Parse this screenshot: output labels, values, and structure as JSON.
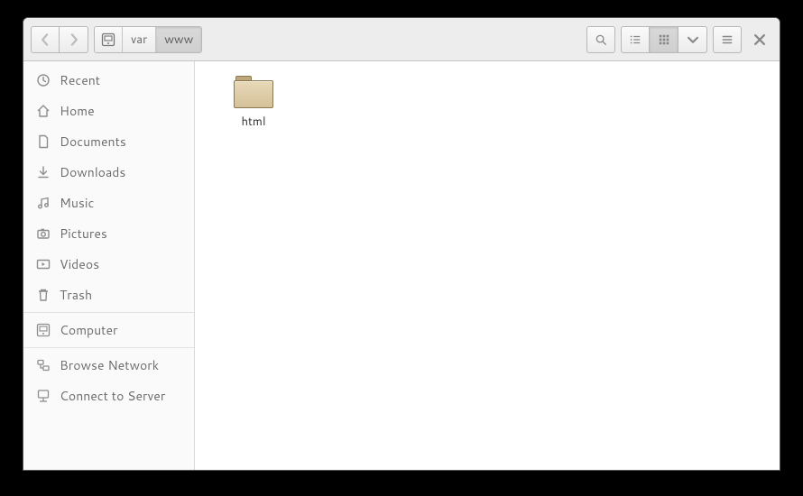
{
  "pathbar": {
    "segments": [
      {
        "kind": "root-icon",
        "active": false
      },
      {
        "label": "var",
        "active": false
      },
      {
        "label": "www",
        "active": true
      }
    ]
  },
  "toolbar": {
    "back_enabled": false,
    "forward_enabled": false,
    "view_mode": "grid"
  },
  "sidebar": {
    "groups": [
      [
        {
          "id": "recent",
          "label": "Recent",
          "icon": "clock"
        },
        {
          "id": "home",
          "label": "Home",
          "icon": "home"
        },
        {
          "id": "documents",
          "label": "Documents",
          "icon": "doc"
        },
        {
          "id": "downloads",
          "label": "Downloads",
          "icon": "download"
        },
        {
          "id": "music",
          "label": "Music",
          "icon": "music"
        },
        {
          "id": "pictures",
          "label": "Pictures",
          "icon": "camera"
        },
        {
          "id": "videos",
          "label": "Videos",
          "icon": "video"
        },
        {
          "id": "trash",
          "label": "Trash",
          "icon": "trash"
        }
      ],
      [
        {
          "id": "computer",
          "label": "Computer",
          "icon": "computer"
        }
      ],
      [
        {
          "id": "browse-network",
          "label": "Browse Network",
          "icon": "network"
        },
        {
          "id": "connect-to-server",
          "label": "Connect to Server",
          "icon": "server"
        }
      ]
    ]
  },
  "files": [
    {
      "name": "html",
      "type": "folder"
    }
  ]
}
